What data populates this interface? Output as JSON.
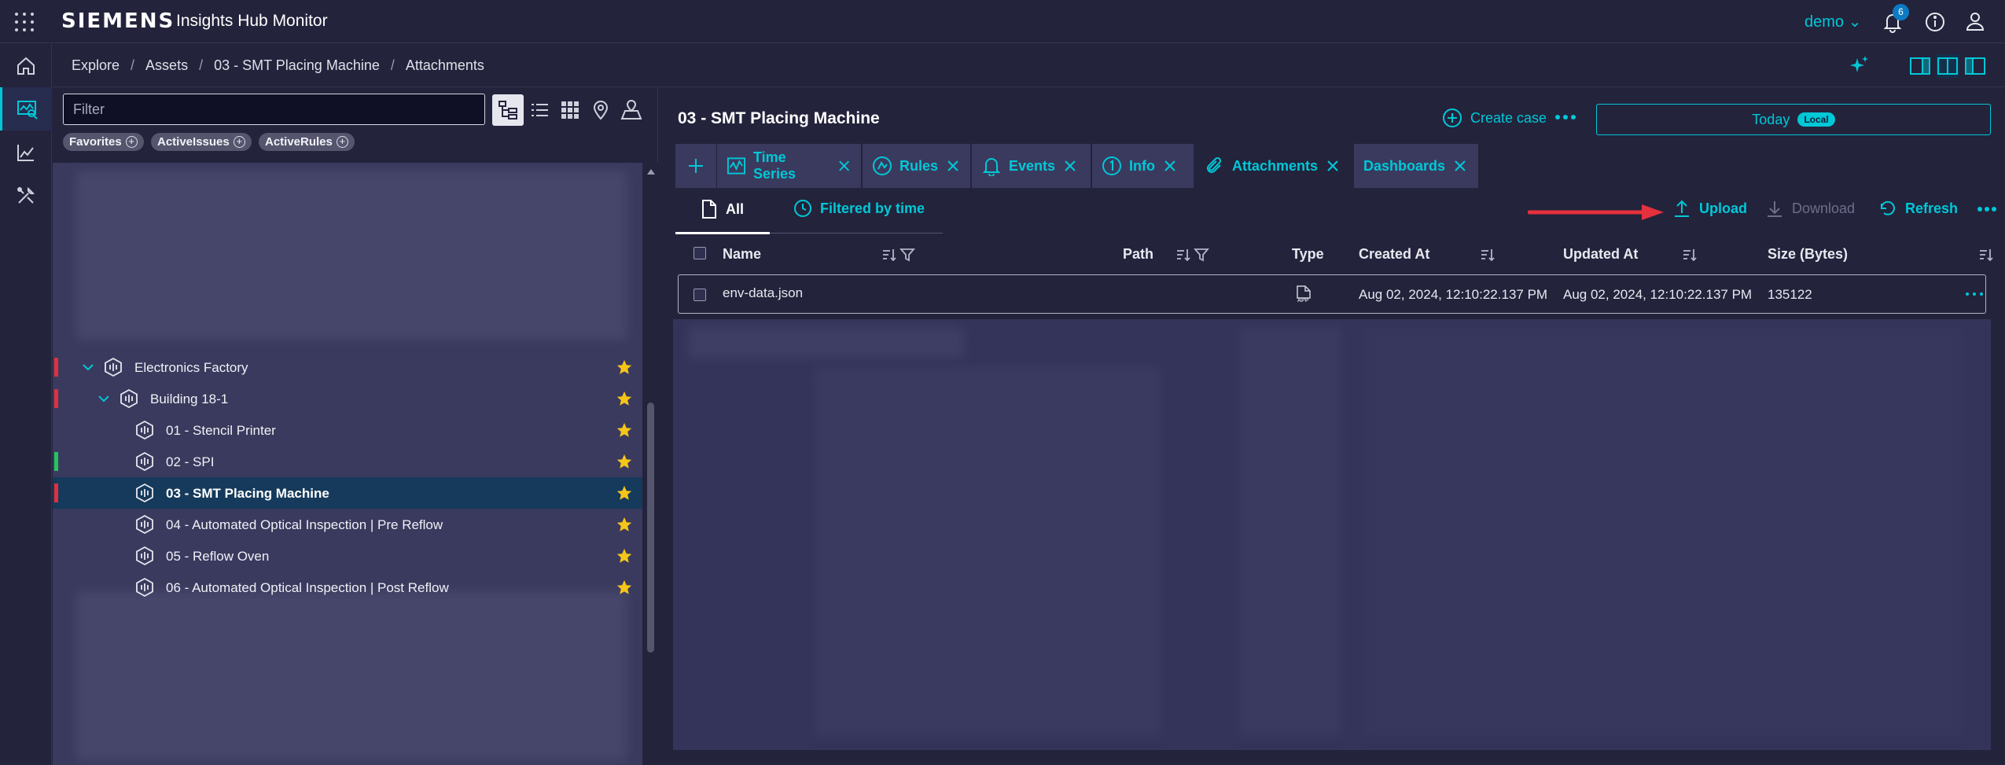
{
  "header": {
    "brand": "SIEMENS",
    "app_name": "Insights Hub Monitor",
    "user": "demo",
    "notification_count": "6"
  },
  "breadcrumb": [
    "Explore",
    "Assets",
    "03 - SMT Placing Machine",
    "Attachments"
  ],
  "tree": {
    "filter_placeholder": "Filter",
    "chips": [
      "Favorites",
      "ActiveIssues",
      "ActiveRules"
    ],
    "items": [
      {
        "label": "Electronics Factory",
        "status": "#e0303f",
        "favorite": true
      },
      {
        "label": "Building 18-1",
        "status": "#e0303f",
        "favorite": true
      },
      {
        "label": "01 - Stencil Printer",
        "status": "",
        "favorite": true
      },
      {
        "label": "02 - SPI",
        "status": "#22c55e",
        "favorite": true
      },
      {
        "label": "03 - SMT Placing Machine",
        "status": "#e0303f",
        "favorite": true,
        "selected": true
      },
      {
        "label": "04 - Automated Optical Inspection | Pre Reflow",
        "status": "",
        "favorite": true
      },
      {
        "label": "05 - Reflow Oven",
        "status": "",
        "favorite": true
      },
      {
        "label": "06 - Automated Optical Inspection | Post Reflow",
        "status": "",
        "favorite": true
      }
    ]
  },
  "main": {
    "title": "03 - SMT Placing Machine",
    "create_case": "Create case",
    "time_range": "Today",
    "time_zone_badge": "Local",
    "tabs": [
      "Time Series",
      "Rules",
      "Events",
      "Info",
      "Attachments",
      "Dashboards"
    ],
    "active_tab": "Attachments",
    "subtabs": {
      "all": "All",
      "filtered": "Filtered by time"
    },
    "actions": {
      "upload": "Upload",
      "download": "Download",
      "refresh": "Refresh"
    },
    "columns": [
      "Name",
      "Path",
      "Type",
      "Created At",
      "Updated At",
      "Size (Bytes)"
    ],
    "rows": [
      {
        "name": "env-data.json",
        "path": "",
        "type": "APP",
        "created": "Aug 02, 2024, 12:10:22.137 PM",
        "updated": "Aug 02, 2024, 12:10:22.137 PM",
        "size": "135122"
      }
    ]
  },
  "colors": {
    "accent": "#00c8d7",
    "background": "#23233c",
    "panel": "#3a3a5e",
    "annotation_arrow": "#e5313c",
    "star": "#f5c518"
  }
}
